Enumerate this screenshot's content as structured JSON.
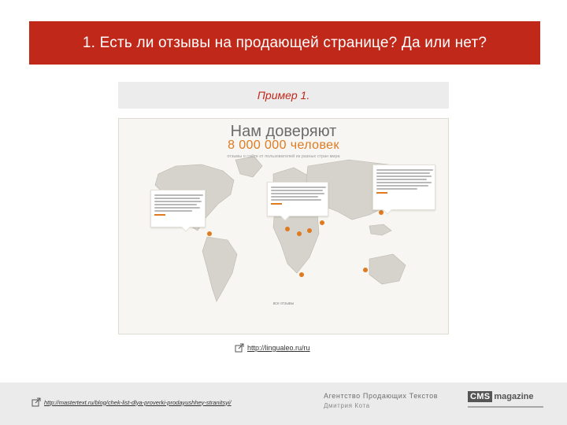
{
  "slide": {
    "title": "1. Есть ли отзывы на продающей странице? Да или нет?",
    "example_label": "Пример 1."
  },
  "screenshot": {
    "heading": "Нам доверяют",
    "count_line": "8 000 000 человек",
    "subheading": "отзывы о сайте от пользователей из разных стран мира",
    "footer_text": "все отзывы"
  },
  "links": {
    "source_url": "http://lingualeo.ru/ru",
    "footer_url": "http://mastertext.ru/blog/chek-list-dlya-proverki-prodayushhey-stranitsyi/"
  },
  "agency": {
    "line1": "Агентство Продающих Текстов",
    "line2": "Дмитрия Кота"
  },
  "cms_logo": {
    "box_text": "CMS",
    "rest_text": "magazine"
  },
  "icons": [
    "external-link-icon",
    "map-pin-icon"
  ],
  "colors": {
    "title_bar": "#c0291a",
    "accent_orange": "#e07a1f",
    "example_bar": "#ececec",
    "footer_band": "#ebebeb"
  }
}
